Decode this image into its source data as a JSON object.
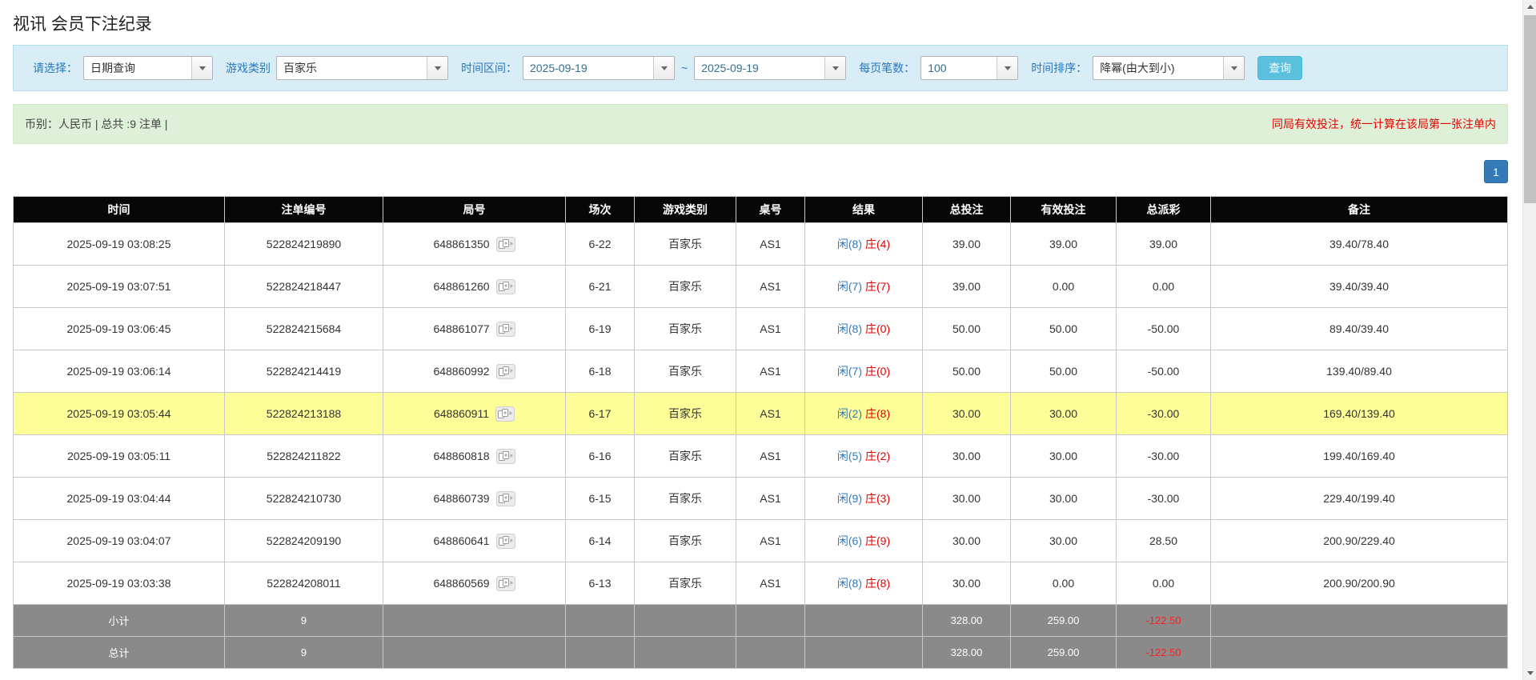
{
  "page": {
    "title": "视讯 会员下注纪录"
  },
  "filters": {
    "select_label": "请选择：",
    "select_value": "日期查询",
    "game_type_label": "游戏类别",
    "game_type_value": "百家乐",
    "date_range_label": "时间区间：",
    "date_from": "2025-09-19",
    "range_separator": "~",
    "date_to": "2025-09-19",
    "page_size_label": "每页笔数：",
    "page_size_value": "100",
    "sort_label": "时间排序：",
    "sort_value": "降幂(由大到小)",
    "search_button_label": "查询"
  },
  "summary": {
    "currency_info": "币别：人民币 | 总共 :9 注单 |",
    "notice": "同局有效投注，统一计算在该局第一张注单内"
  },
  "pagination": {
    "current_page": "1"
  },
  "table": {
    "headers": [
      "时间",
      "注单编号",
      "局号",
      "场次",
      "游戏类别",
      "桌号",
      "结果",
      "总投注",
      "有效投注",
      "总派彩",
      "备注"
    ],
    "rows": [
      {
        "time": "2025-09-19 03:08:25",
        "bet_id": "522824219890",
        "round_id": "648861350",
        "session": "6-22",
        "game": "百家乐",
        "table_no": "AS1",
        "result_player": "闲(8)",
        "result_banker": "庄(4)",
        "total_bet": "39.00",
        "valid_bet": "39.00",
        "payout": "39.00",
        "remark": "39.40/78.40",
        "highlighted": false
      },
      {
        "time": "2025-09-19 03:07:51",
        "bet_id": "522824218447",
        "round_id": "648861260",
        "session": "6-21",
        "game": "百家乐",
        "table_no": "AS1",
        "result_player": "闲(7)",
        "result_banker": "庄(7)",
        "total_bet": "39.00",
        "valid_bet": "0.00",
        "payout": "0.00",
        "remark": "39.40/39.40",
        "highlighted": false
      },
      {
        "time": "2025-09-19 03:06:45",
        "bet_id": "522824215684",
        "round_id": "648861077",
        "session": "6-19",
        "game": "百家乐",
        "table_no": "AS1",
        "result_player": "闲(8)",
        "result_banker": "庄(0)",
        "total_bet": "50.00",
        "valid_bet": "50.00",
        "payout": "-50.00",
        "remark": "89.40/39.40",
        "highlighted": false
      },
      {
        "time": "2025-09-19 03:06:14",
        "bet_id": "522824214419",
        "round_id": "648860992",
        "session": "6-18",
        "game": "百家乐",
        "table_no": "AS1",
        "result_player": "闲(7)",
        "result_banker": "庄(0)",
        "total_bet": "50.00",
        "valid_bet": "50.00",
        "payout": "-50.00",
        "remark": "139.40/89.40",
        "highlighted": false
      },
      {
        "time": "2025-09-19 03:05:44",
        "bet_id": "522824213188",
        "round_id": "648860911",
        "session": "6-17",
        "game": "百家乐",
        "table_no": "AS1",
        "result_player": "闲(2)",
        "result_banker": "庄(8)",
        "total_bet": "30.00",
        "valid_bet": "30.00",
        "payout": "-30.00",
        "remark": "169.40/139.40",
        "highlighted": true
      },
      {
        "time": "2025-09-19 03:05:11",
        "bet_id": "522824211822",
        "round_id": "648860818",
        "session": "6-16",
        "game": "百家乐",
        "table_no": "AS1",
        "result_player": "闲(5)",
        "result_banker": "庄(2)",
        "total_bet": "30.00",
        "valid_bet": "30.00",
        "payout": "-30.00",
        "remark": "199.40/169.40",
        "highlighted": false
      },
      {
        "time": "2025-09-19 03:04:44",
        "bet_id": "522824210730",
        "round_id": "648860739",
        "session": "6-15",
        "game": "百家乐",
        "table_no": "AS1",
        "result_player": "闲(9)",
        "result_banker": "庄(3)",
        "total_bet": "30.00",
        "valid_bet": "30.00",
        "payout": "-30.00",
        "remark": "229.40/199.40",
        "highlighted": false
      },
      {
        "time": "2025-09-19 03:04:07",
        "bet_id": "522824209190",
        "round_id": "648860641",
        "session": "6-14",
        "game": "百家乐",
        "table_no": "AS1",
        "result_player": "闲(6)",
        "result_banker": "庄(9)",
        "total_bet": "30.00",
        "valid_bet": "30.00",
        "payout": "28.50",
        "remark": "200.90/229.40",
        "highlighted": false
      },
      {
        "time": "2025-09-19 03:03:38",
        "bet_id": "522824208011",
        "round_id": "648860569",
        "session": "6-13",
        "game": "百家乐",
        "table_no": "AS1",
        "result_player": "闲(8)",
        "result_banker": "庄(8)",
        "total_bet": "30.00",
        "valid_bet": "0.00",
        "payout": "0.00",
        "remark": "200.90/200.90",
        "highlighted": false
      }
    ],
    "subtotal": {
      "label": "小计",
      "count": "9",
      "total_bet": "328.00",
      "valid_bet": "259.00",
      "payout": "-122.50"
    },
    "total": {
      "label": "总计",
      "count": "9",
      "total_bet": "328.00",
      "valid_bet": "259.00",
      "payout": "-122.50"
    }
  },
  "icons": {
    "dropdown": "chevron-down-icon",
    "game_detail": "game-detail-icon",
    "scroll_up": "scroll-up-arrow-icon",
    "scroll_down": "scroll-down-arrow-icon"
  },
  "colors": {
    "header_bg": "#070707",
    "highlight_row": "#ffff99",
    "player_blue": "#337ab7",
    "banker_red": "#e60000",
    "negative_red": "#e60000",
    "footer_bg": "#8a8a8a",
    "filter_panel_bg": "#d9edf7",
    "summary_bar_bg": "#dff0d8",
    "search_button_bg": "#5bc0de",
    "pagination_bg": "#337ab7"
  }
}
